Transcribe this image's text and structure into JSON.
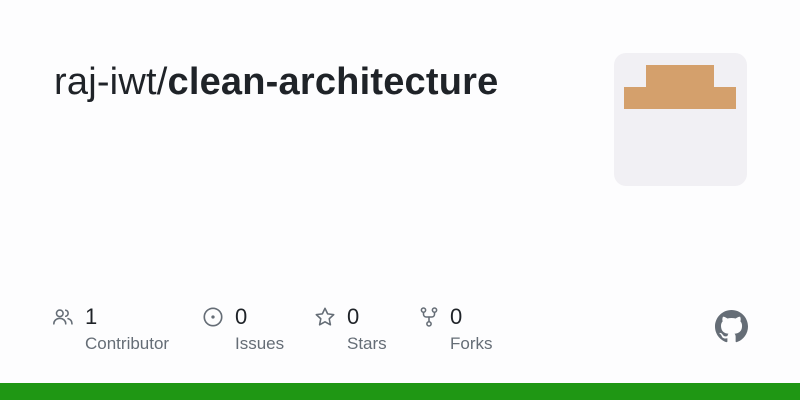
{
  "repo": {
    "owner": "raj-iwt",
    "separator": "/",
    "name": "clean-architecture"
  },
  "stats": [
    {
      "icon": "people-icon",
      "count": "1",
      "label": "Contributor"
    },
    {
      "icon": "issue-circle-icon",
      "count": "0",
      "label": "Issues"
    },
    {
      "icon": "star-icon",
      "count": "0",
      "label": "Stars"
    },
    {
      "icon": "fork-icon",
      "count": "0",
      "label": "Forks"
    }
  ],
  "colors": {
    "language_bar": "#1f9714",
    "avatar_background": "#f1f0f4",
    "avatar_block": "#d4a06c",
    "icon_gray": "#656d76",
    "github_mark": "#656d76"
  },
  "icons": {
    "brand": "github-mark-icon"
  }
}
